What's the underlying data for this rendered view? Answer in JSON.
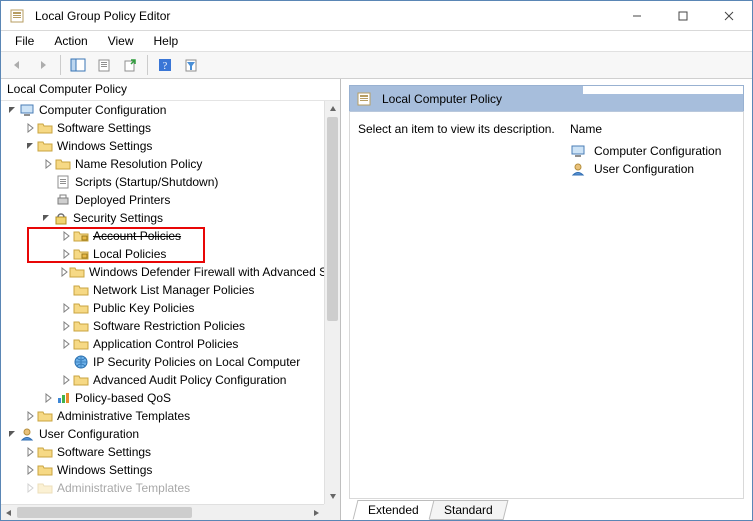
{
  "window": {
    "title": "Local Group Policy Editor"
  },
  "menu": {
    "file": "File",
    "action": "Action",
    "view": "View",
    "help": "Help"
  },
  "left": {
    "header": "Local Computer Policy",
    "root": {
      "label": "Computer Configuration",
      "software": "Software Settings",
      "windows": {
        "label": "Windows Settings",
        "nrp": "Name Resolution Policy",
        "scripts": "Scripts (Startup/Shutdown)",
        "printers": "Deployed Printers",
        "security": {
          "label": "Security Settings",
          "account": "Account Policies",
          "local": "Local Policies",
          "firewall": "Windows Defender Firewall with Advanced Security",
          "netlist": "Network List Manager Policies",
          "pubkey": "Public Key Policies",
          "srp": "Software Restriction Policies",
          "acp": "Application Control Policies",
          "ipsec": "IP Security Policies on Local Computer",
          "audit": "Advanced Audit Policy Configuration"
        },
        "qos": "Policy-based QoS"
      },
      "admin": "Administrative Templates"
    },
    "user": {
      "label": "User Configuration",
      "software": "Software Settings",
      "windows": "Windows Settings",
      "admin": "Administrative Templates"
    }
  },
  "right": {
    "title": "Local Computer Policy",
    "desc": "Select an item to view its description.",
    "name_col": "Name",
    "items": {
      "cc": "Computer Configuration",
      "uc": "User Configuration"
    }
  },
  "tabs": {
    "extended": "Extended",
    "standard": "Standard"
  }
}
